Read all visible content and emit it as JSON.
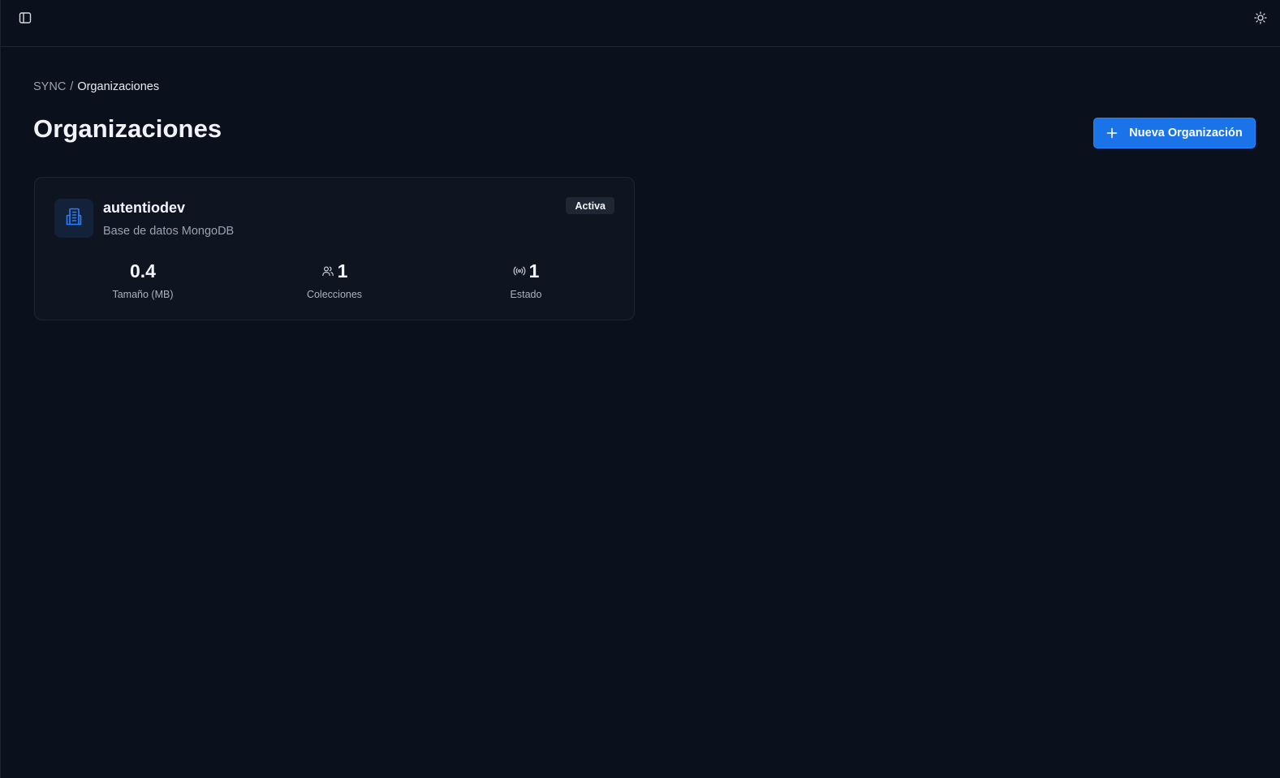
{
  "breadcrumb": {
    "root": "SYNC",
    "separator": "/",
    "current": "Organizaciones"
  },
  "header": {
    "title": "Organizaciones",
    "new_button_label": "Nueva Organización"
  },
  "icons": {
    "sidebar_toggle": "sidebar-panel-icon",
    "theme_toggle": "sun-icon",
    "plus": "plus-icon",
    "organization": "building-icon",
    "collections": "users-icon",
    "status": "broadcast-icon"
  },
  "colors": {
    "accent": "#1a73e8",
    "background": "#0b111c",
    "card": "#0f1520"
  },
  "organizations": [
    {
      "name": "autentiodev",
      "description": "Base de datos MongoDB",
      "status": "Activa",
      "stats": [
        {
          "value": "0.4",
          "label": "Tamaño (MB)"
        },
        {
          "value": "1",
          "label": "Colecciones"
        },
        {
          "value": "1",
          "label": "Estado"
        }
      ]
    }
  ]
}
